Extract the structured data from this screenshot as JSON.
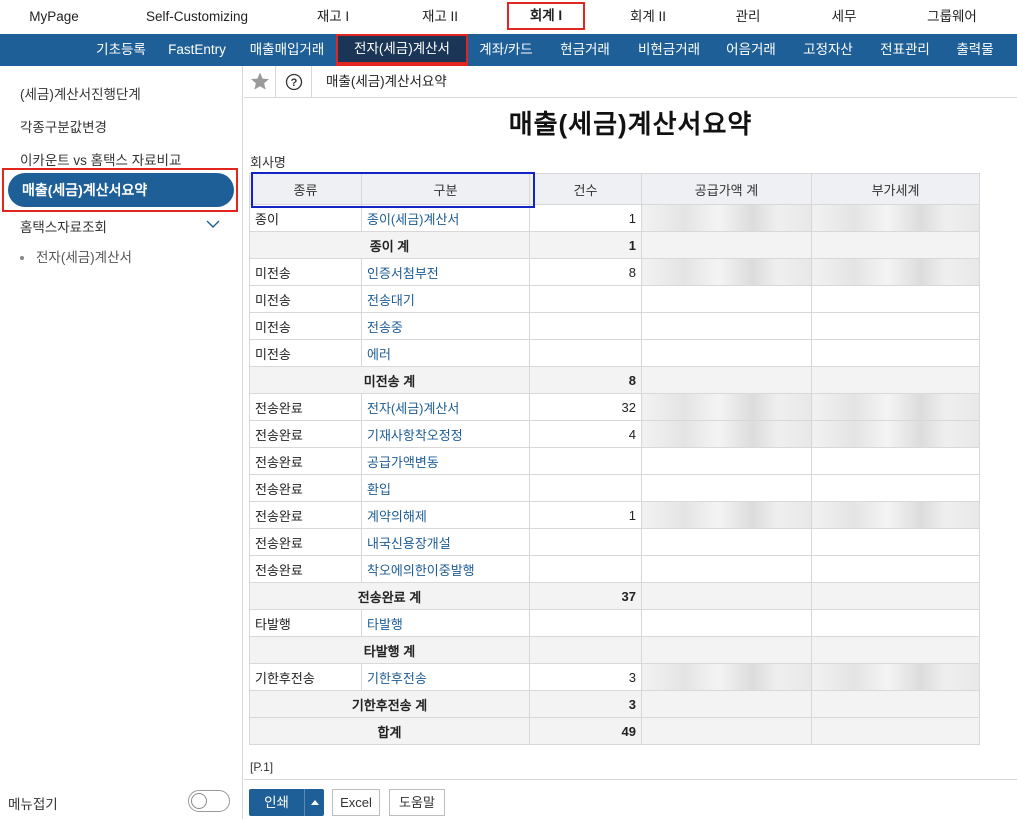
{
  "top_menu": [
    {
      "label": "MyPage"
    },
    {
      "label": "Self-Customizing"
    },
    {
      "label": "재고 I"
    },
    {
      "label": "재고 II"
    },
    {
      "label": "회계 I"
    },
    {
      "label": "회계 II"
    },
    {
      "label": "관리"
    },
    {
      "label": "세무"
    },
    {
      "label": "그룹웨어"
    }
  ],
  "sub_menu": [
    {
      "label": "기초등록"
    },
    {
      "label": "FastEntry"
    },
    {
      "label": "매출매입거래"
    },
    {
      "label": "전자(세금)계산서"
    },
    {
      "label": "계좌/카드"
    },
    {
      "label": "현금거래"
    },
    {
      "label": "비현금거래"
    },
    {
      "label": "어음거래"
    },
    {
      "label": "고정자산"
    },
    {
      "label": "전표관리"
    },
    {
      "label": "출력물"
    }
  ],
  "sidebar": {
    "items": [
      {
        "label": "(세금)계산서진행단계"
      },
      {
        "label": "각종구분값변경"
      },
      {
        "label": "이카운트 vs 홈택스 자료비교"
      },
      {
        "label": "매출(세금)계산서요약"
      },
      {
        "label": "홈택스자료조회"
      }
    ],
    "sub_item": "전자(세금)계산서",
    "menu_fold_label": "메뉴접기",
    "menu_fold_on": false
  },
  "breadcrumb": "매출(세금)계산서요약",
  "title": "매출(세금)계산서요약",
  "company_label": "회사명",
  "table": {
    "headers": [
      "종류",
      "구분",
      "건수",
      "공급가액 계",
      "부가세계"
    ],
    "rows": [
      {
        "type": "종이",
        "category": "종이(세금)계산서",
        "count": "1"
      },
      {
        "subtotal": "종이 계",
        "count": "1"
      },
      {
        "type": "미전송",
        "category": "인증서첨부전",
        "count": "8"
      },
      {
        "type": "미전송",
        "category": "전송대기",
        "count": ""
      },
      {
        "type": "미전송",
        "category": "전송중",
        "count": ""
      },
      {
        "type": "미전송",
        "category": "에러",
        "count": ""
      },
      {
        "subtotal": "미전송 계",
        "count": "8"
      },
      {
        "type": "전송완료",
        "category": "전자(세금)계산서",
        "count": "32"
      },
      {
        "type": "전송완료",
        "category": "기재사항착오정정",
        "count": "4"
      },
      {
        "type": "전송완료",
        "category": "공급가액변동",
        "count": ""
      },
      {
        "type": "전송완료",
        "category": "환입",
        "count": ""
      },
      {
        "type": "전송완료",
        "category": "계약의해제",
        "count": "1"
      },
      {
        "type": "전송완료",
        "category": "내국신용장개설",
        "count": ""
      },
      {
        "type": "전송완료",
        "category": "착오에의한이중발행",
        "count": ""
      },
      {
        "subtotal": "전송완료 계",
        "count": "37"
      },
      {
        "type": "타발행",
        "category": "타발행",
        "count": ""
      },
      {
        "subtotal": "타발행 계",
        "count": ""
      },
      {
        "type": "기한후전송",
        "category": "기한후전송",
        "count": "3"
      },
      {
        "subtotal": "기한후전송 계",
        "count": "3"
      },
      {
        "subtotal": "합계",
        "count": "49"
      }
    ]
  },
  "page_number": "[P.1]",
  "buttons": {
    "print": "인쇄",
    "excel": "Excel",
    "help": "도움말"
  },
  "colors": {
    "primary": "#1f5f97",
    "highlight_red": "#e0261f",
    "highlight_blue": "#1424c8",
    "link": "#1d5c96"
  },
  "icons": [
    "star-icon",
    "help-circle-icon",
    "chevron-down-icon",
    "caret-up-icon"
  ]
}
